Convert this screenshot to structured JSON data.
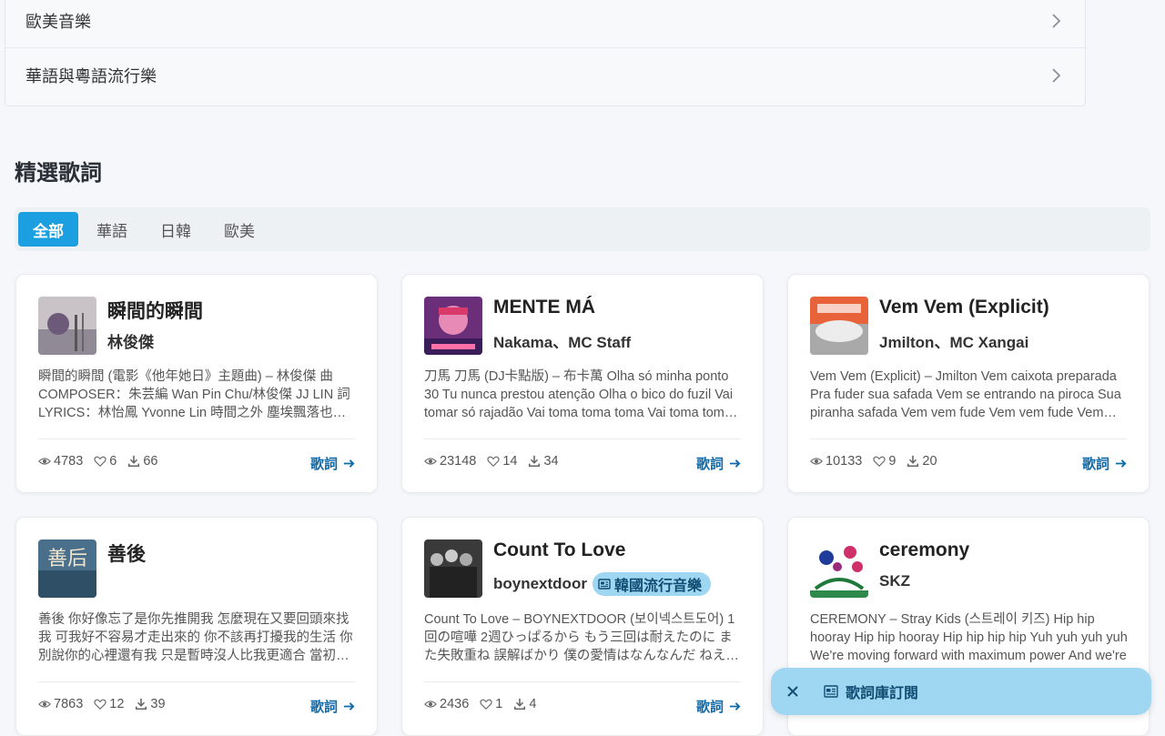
{
  "categories": [
    {
      "label": "歐美音樂"
    },
    {
      "label": "華語與粵語流行樂"
    }
  ],
  "section": {
    "title": "精選歌詞"
  },
  "tabs": [
    {
      "label": "全部"
    },
    {
      "label": "華語"
    },
    {
      "label": "日韓"
    },
    {
      "label": "歐美"
    }
  ],
  "cards": [
    {
      "title": "瞬間的瞬間",
      "artist": "林俊傑",
      "snippet": "瞬間的瞬間 (電影《他年她日》主題曲) – 林俊傑 曲 COMPOSER：朱芸編 Wan Pin Chu/林俊傑 JJ LIN 詞 LYRICS：林怡鳳 Yvonne Lin 時間之外 塵埃飄落也糾纏 每一次",
      "views": "4783",
      "likes": "6",
      "downloads": "66",
      "link": "歌詞"
    },
    {
      "title": "MENTE MÁ",
      "artist": "Nakama、MC Staff",
      "snippet": "刀馬 刀馬 (DJ卡點版) – 布卡萬 Olha só minha ponto 30 Tu nunca prestou atenção Olha o bico do fuzil Vai tomar só rajadão Vai toma toma toma Vai toma toma toma",
      "views": "23148",
      "likes": "14",
      "downloads": "34",
      "link": "歌詞"
    },
    {
      "title": "Vem Vem (Explicit)",
      "artist": "Jmilton、MC Xangai",
      "snippet": "Vem Vem (Explicit) – Jmilton Vem caixota preparada Pra fuder sua safada Vem se entrando na piroca Sua piranha safada Vem vem fude Vem vem fude Vem vem fude",
      "views": "10133",
      "likes": "9",
      "downloads": "20",
      "link": "歌詞"
    },
    {
      "title": "善後",
      "artist": "",
      "snippet": "善後 你好像忘了是你先推開我 怎麼現在又要回頭來找我 可我好不容易才走出來的 你不該再打擾我的生活 你別說你的心裡還有我 只是暫時沒人比我更適合 當初在我滿身傷痕的時候",
      "views": "7863",
      "likes": "12",
      "downloads": "39",
      "link": "歌詞"
    },
    {
      "title": "Count To Love",
      "artist": "boynextdoor",
      "genre": "韓國流行音樂",
      "snippet": "Count To Love – BOYNEXTDOOR (보이넥스트도어) 1回の喧嘩 2週ひっぱるから もう三回は耐えたのに また失敗重ね 誤解ばかり 僕の愛情はなんなんだ ねえどうしたらいい",
      "views": "2436",
      "likes": "1",
      "downloads": "4",
      "link": "歌詞"
    },
    {
      "title": "ceremony",
      "artist": "SKZ",
      "snippet": "CEREMONY – Stray Kids (스트레이 키즈) Hip hip hooray Hip hip hooray Hip hip hip hip Yuh yuh yuh yuh We're moving forward with maximum power And we're",
      "views": "",
      "likes": "",
      "downloads": "",
      "link": ""
    }
  ],
  "toast": {
    "label": "歌詞庫訂閱"
  },
  "colors": {
    "accent": "#1c9fe0",
    "link": "#0f6aa8",
    "toast_bg": "#9fd7f3"
  },
  "icons": {
    "chevron": "chevron-right-icon",
    "views": "eye-icon",
    "likes": "heart-icon",
    "downloads": "download-icon",
    "link": "arrow-right-icon",
    "close": "close-icon",
    "subscribe": "newspaper-icon"
  }
}
